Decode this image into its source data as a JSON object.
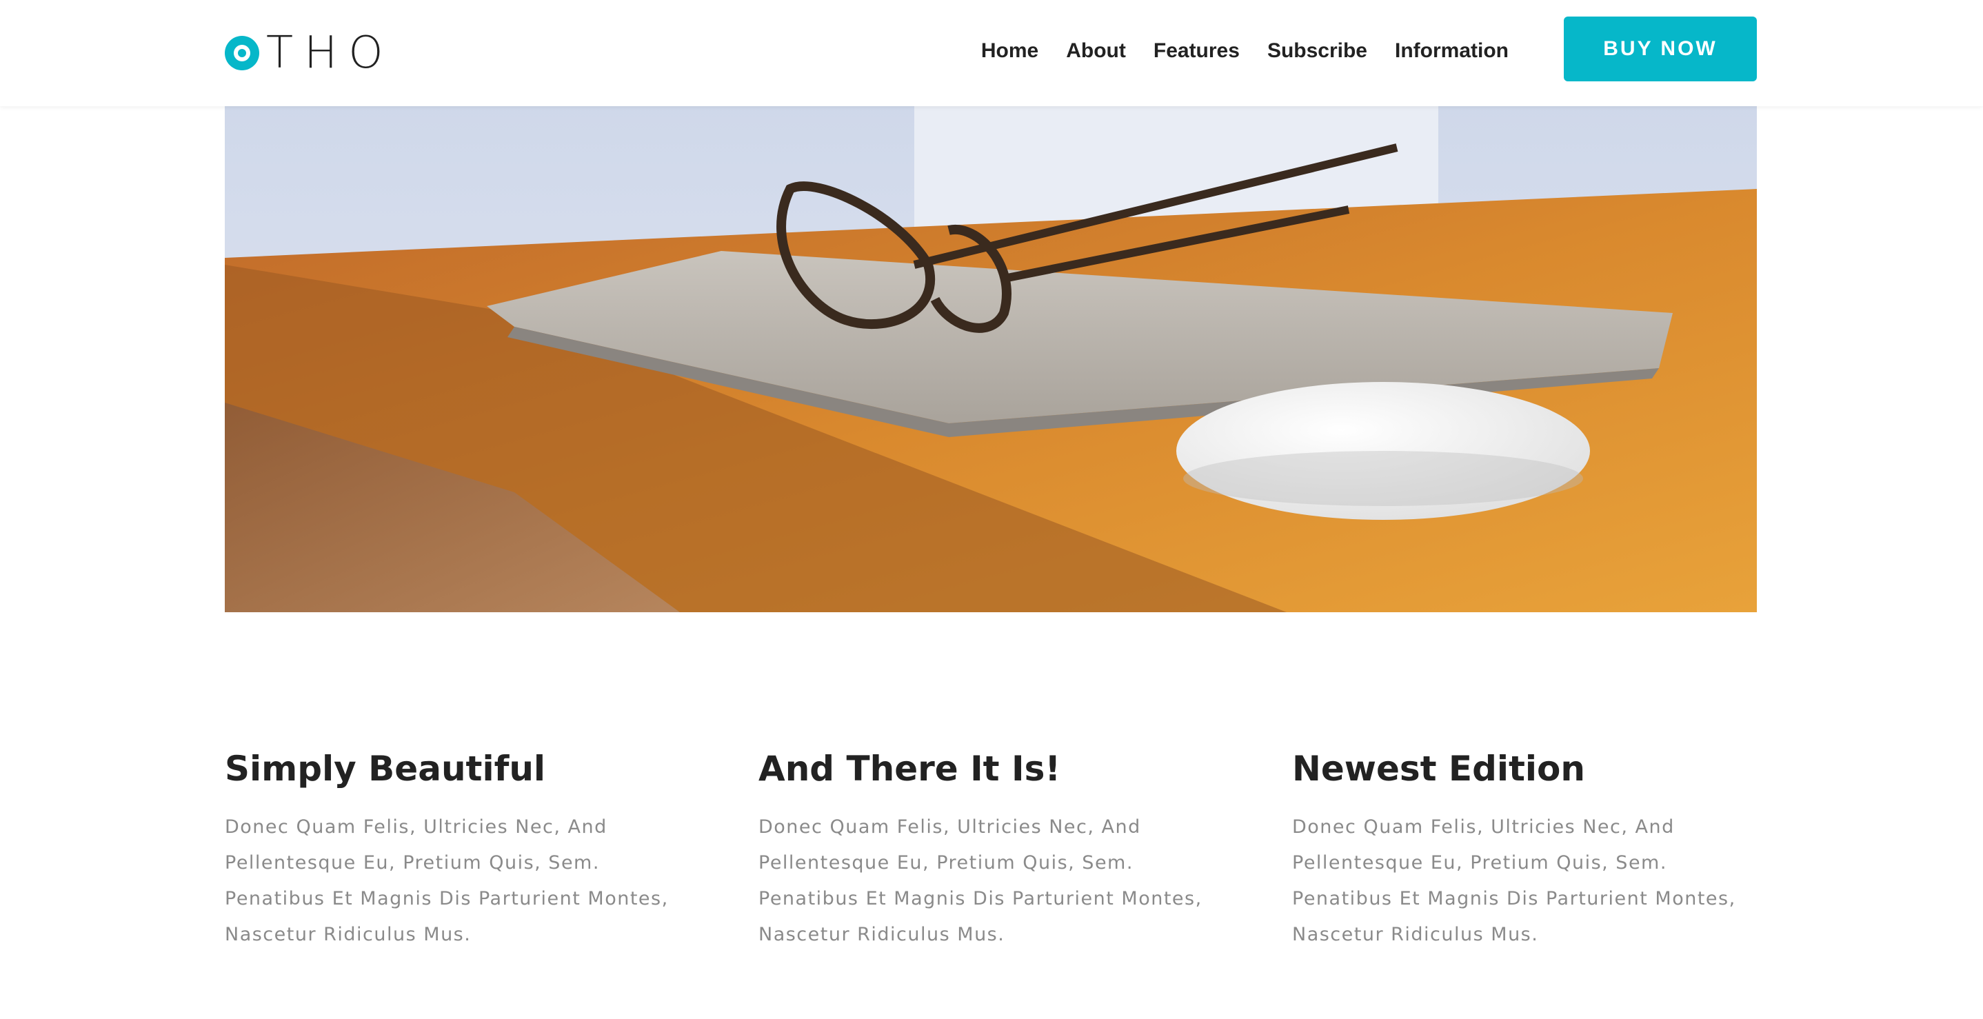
{
  "brand": {
    "logo_text": "THO",
    "logo_icon": "ring-o-icon",
    "accent_color": "#06b7c9"
  },
  "nav": {
    "items": [
      "Home",
      "About",
      "Features",
      "Subscribe",
      "Information"
    ]
  },
  "cta": {
    "label": "BUY NOW"
  },
  "hero": {
    "image_alt": "Laptop with glasses and mouse on wooden desk"
  },
  "features": [
    {
      "title": "Simply Beautiful",
      "text": "Donec Quam Felis, Ultricies Nec, And Pellentesque Eu, Pretium Quis, Sem. Penatibus Et Magnis Dis Parturient Montes, Nascetur Ridiculus Mus."
    },
    {
      "title": "And There It Is!",
      "text": "Donec Quam Felis, Ultricies Nec, And Pellentesque Eu, Pretium Quis, Sem. Penatibus Et Magnis Dis Parturient Montes, Nascetur Ridiculus Mus."
    },
    {
      "title": "Newest Edition",
      "text": "Donec Quam Felis, Ultricies Nec, And Pellentesque Eu, Pretium Quis, Sem. Penatibus Et Magnis Dis Parturient Montes, Nascetur Ridiculus Mus."
    }
  ]
}
